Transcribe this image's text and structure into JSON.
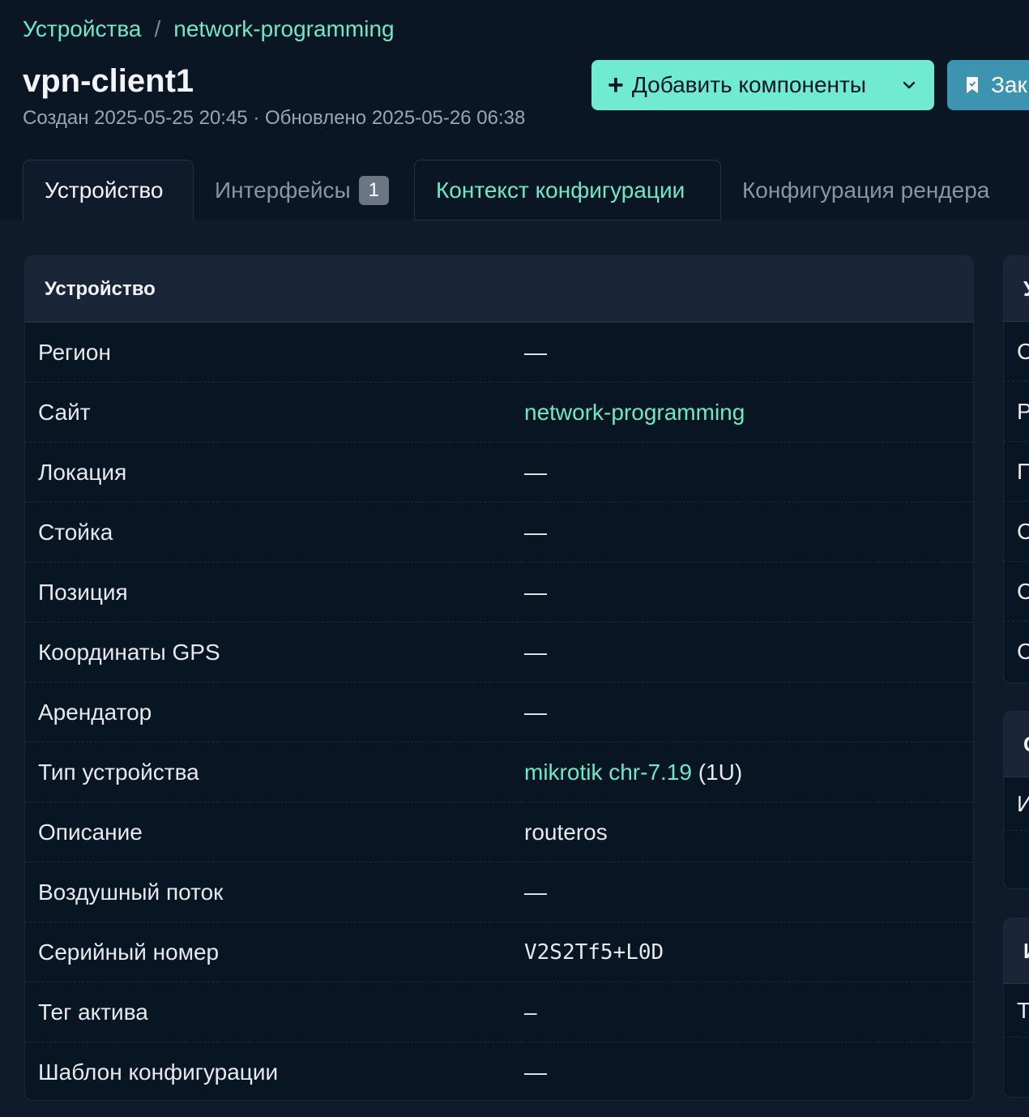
{
  "breadcrumb": {
    "items": [
      "Устройства",
      "network-programming"
    ],
    "separator": "/"
  },
  "device": {
    "title": "vpn-client1",
    "meta": "Создан 2025-05-25 20:45 · Обновлено 2025-05-26 06:38"
  },
  "actions": {
    "add_components_label": "Добавить компоненты",
    "bookmark_label": "Зак"
  },
  "tabs": [
    {
      "label": "Устройство",
      "state": "active"
    },
    {
      "label": "Интерфейсы",
      "badge": "1",
      "state": "inactive"
    },
    {
      "label": "Контекст конфигурации",
      "state": "accent"
    },
    {
      "label": "Конфигурация рендера",
      "state": "inactive"
    }
  ],
  "card": {
    "title": "Устройство",
    "rows": [
      {
        "label": "Регион",
        "value": "—"
      },
      {
        "label": "Сайт",
        "value": "network-programming"
      },
      {
        "label": "Локация",
        "value": "—"
      },
      {
        "label": "Стойка",
        "value": "—"
      },
      {
        "label": "Позиция",
        "value": "—"
      },
      {
        "label": "Координаты GPS",
        "value": "—"
      },
      {
        "label": "Арендатор",
        "value": "—"
      },
      {
        "label": "Тип устройства",
        "value": "mikrotik chr-7.19",
        "suffix": "(1U)"
      },
      {
        "label": "Описание",
        "value": "routeros"
      },
      {
        "label": "Воздушный поток",
        "value": "—"
      },
      {
        "label": "Серийный номер",
        "value": "V2S2Tf5+L0D"
      },
      {
        "label": "Тег актива",
        "value": "–"
      },
      {
        "label": "Шаблон конфигурации",
        "value": "—"
      }
    ]
  },
  "side": {
    "card1": {
      "head": "У",
      "rows": [
        "С",
        "Р",
        "П",
        "С",
        "С",
        "С"
      ]
    },
    "card2": {
      "head": "С",
      "rows": [
        "И",
        ""
      ]
    },
    "card3": {
      "head": "И",
      "rows": [
        "Т",
        ""
      ]
    }
  },
  "colors": {
    "accent": "#6fe8c6",
    "primary_button": "#70ead0",
    "secondary_button": "#3d94b0",
    "background": "#0b1624"
  }
}
